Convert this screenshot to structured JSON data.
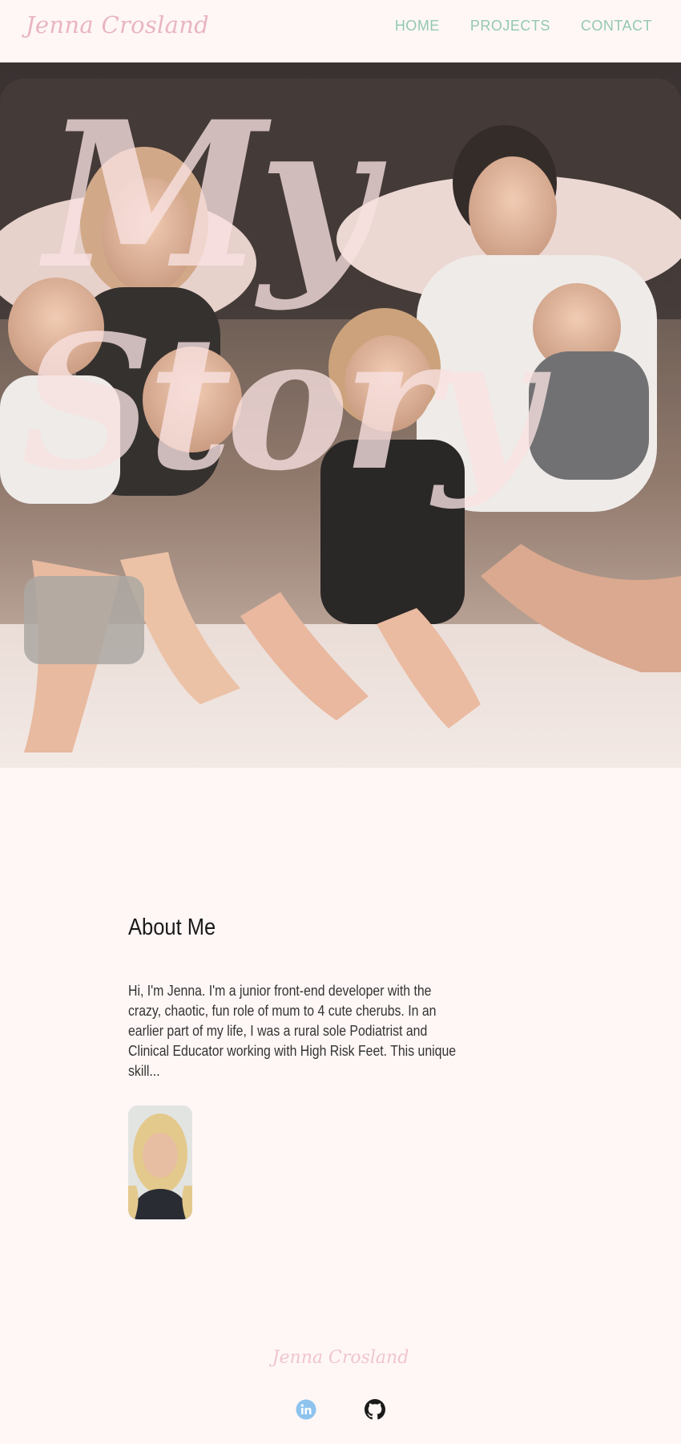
{
  "header": {
    "logo": "Jenna Crosland",
    "nav": [
      "HOME",
      "PROJECTS",
      "CONTACT"
    ]
  },
  "hero": {
    "title_line1": "My",
    "title_line2": "Story"
  },
  "about": {
    "heading": "About Me",
    "body": "Hi, I'm Jenna. I'm a junior front-end developer with the crazy, chaotic, fun role of mum to 4 cute cherubs. In an earlier part of my life, I was a rural sole Podiatrist and Clinical Educator working with High Risk Feet. This unique skill..."
  },
  "footer": {
    "logo": "Jenna Crosland",
    "social_icons": [
      "linkedin-icon",
      "github-icon"
    ]
  },
  "colors": {
    "background": "#fff7f6",
    "logo_pink": "#e9b5c2",
    "nav_green": "#93c8b1",
    "linkedin_blue": "#8ec3ee"
  }
}
